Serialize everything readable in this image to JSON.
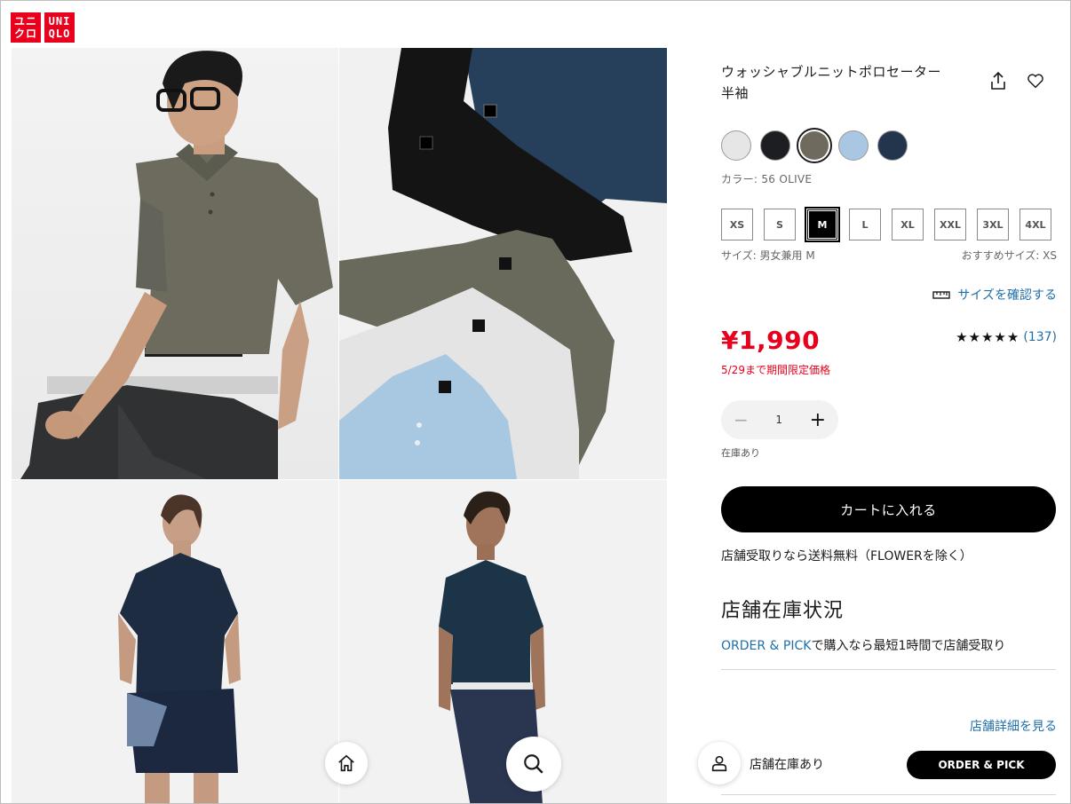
{
  "brand": {
    "logo_left": [
      "ユニ",
      "クロ"
    ],
    "logo_right": [
      "UNI",
      "QLO"
    ]
  },
  "product": {
    "title_line1": "ウォッシャブルニットポロセーター",
    "title_line2": "半袖",
    "share_icon": "share-icon",
    "favorite_icon": "heart-icon"
  },
  "colors": {
    "swatches": [
      {
        "name": "light-gray",
        "hex": "#e6e6e6"
      },
      {
        "name": "black",
        "hex": "#1c1e22"
      },
      {
        "name": "olive",
        "hex": "#6f6a5e",
        "selected": true
      },
      {
        "name": "light-blue",
        "hex": "#a9c6e2"
      },
      {
        "name": "navy",
        "hex": "#23344d"
      }
    ],
    "label": "カラー: 56 OLIVE"
  },
  "sizes": {
    "options": [
      "XS",
      "S",
      "M",
      "L",
      "XL",
      "XXL",
      "3XL",
      "4XL"
    ],
    "selected": "M",
    "label": "サイズ: 男女兼用 M",
    "recommended": "おすすめサイズ: XS",
    "check_link": "サイズを確認する",
    "check_icon": "ruler-icon"
  },
  "price": {
    "amount": "¥1,990",
    "note": "5/29まで期間限定価格"
  },
  "rating": {
    "stars": "★★★★★",
    "value": 4.5,
    "reviews": "(137)"
  },
  "quantity": {
    "minus": "−",
    "value": "1",
    "plus": "+",
    "stock": "在庫あり"
  },
  "cart": {
    "button": "カートに入れる"
  },
  "shipping_note": "店舗受取りなら送料無料（FLOWERを除く）",
  "store": {
    "heading": "店舗在庫状況",
    "order_pick_link": "ORDER & PICK",
    "order_pick_text": "で購入なら最短1時間で店舗受取り",
    "detail_link": "店舗詳細を見る",
    "status": "店舗在庫あり",
    "order_pick_button": "ORDER & PICK"
  },
  "floating": {
    "home_icon": "home-icon",
    "search_icon": "search-icon",
    "account_icon": "user-icon"
  },
  "accent": {
    "red": "#e8001c",
    "link": "#1f6fa8"
  }
}
